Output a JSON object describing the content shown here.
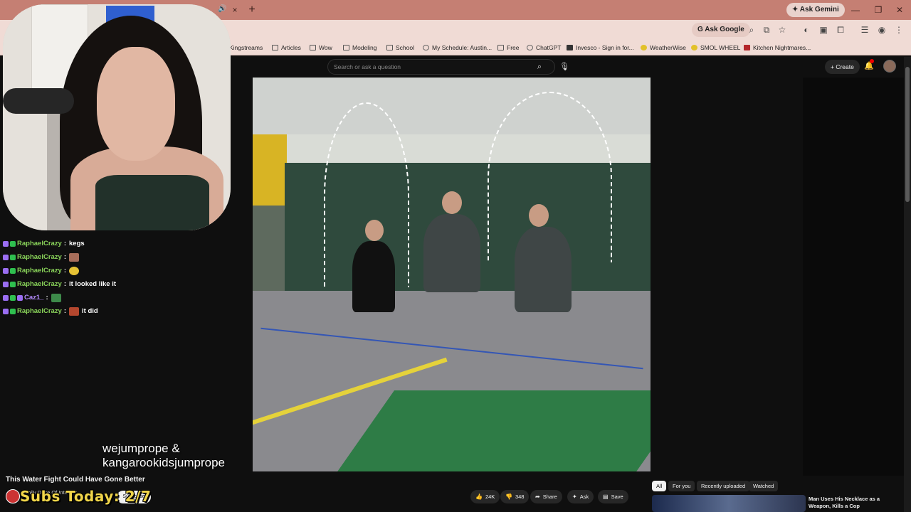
{
  "browser": {
    "ask_gemini": "Ask Gemini",
    "ask_google": "Ask Google",
    "new_tab": "+",
    "tab_close": "×",
    "minimize": "—",
    "restore": "❐",
    "close": "✕",
    "bookmarks": [
      {
        "label": "Kingstreams",
        "icon": "folder-icon"
      },
      {
        "label": "Articles",
        "icon": "folder-icon"
      },
      {
        "label": "Wow",
        "icon": "folder-icon"
      },
      {
        "label": "Modeling",
        "icon": "folder-icon"
      },
      {
        "label": "School",
        "icon": "folder-icon"
      },
      {
        "label": "My Schedule: Austin...",
        "icon": "globe-icon"
      },
      {
        "label": "Free",
        "icon": "folder-icon"
      },
      {
        "label": "ChatGPT",
        "icon": "chatgpt-icon"
      },
      {
        "label": "Invesco - Sign in for...",
        "icon": "invesco-icon"
      },
      {
        "label": "WeatherWise",
        "icon": "bolt-icon"
      },
      {
        "label": "SMOL WHEEL",
        "icon": "wheel-icon"
      },
      {
        "label": "Kitchen Nightmares...",
        "icon": "kitchen-icon"
      }
    ]
  },
  "youtube": {
    "search_placeholder": "Search or ask a question",
    "create_label": "Create",
    "video_title": "This Water Fight Could Have Gone Better",
    "channel_name": "Daily Dose Of Internet",
    "subscribe_label": "Subscribe",
    "actions": {
      "likes": "24K",
      "dislikes": "348",
      "share": "Share",
      "ask": "Ask",
      "save": "Save"
    },
    "chips": [
      "All",
      "For you",
      "Recently uploaded",
      "Watched"
    ],
    "recommendation": {
      "title": "Man Uses His Necklace as a Weapon, Kills a Cop"
    }
  },
  "stream": {
    "caption_line1": "wejumprope &",
    "caption_line2": "kangarookidsjumprope",
    "subs_overlay": "Subs Today: 2/7",
    "chat": [
      {
        "user": "RaphaelCrazy",
        "emote": false,
        "message": "kegs"
      },
      {
        "user": "RaphaelCrazy",
        "emote": true,
        "message": ""
      },
      {
        "user": "RaphaelCrazy",
        "emote": true,
        "message": ""
      },
      {
        "user": "RaphaelCrazy",
        "emote": false,
        "message": "it looked like it"
      },
      {
        "user": "Caz1_",
        "emote": true,
        "message": ""
      },
      {
        "user": "RaphaelCrazy",
        "emote": true,
        "message": "it did"
      }
    ]
  },
  "colors": {
    "tab_bar": "#c57f73",
    "toolbar": "#f0dbd5",
    "youtube_bg": "#0f0f0f",
    "chat_username": "#8ad45a",
    "subs_overlay": "#f0d54a"
  }
}
